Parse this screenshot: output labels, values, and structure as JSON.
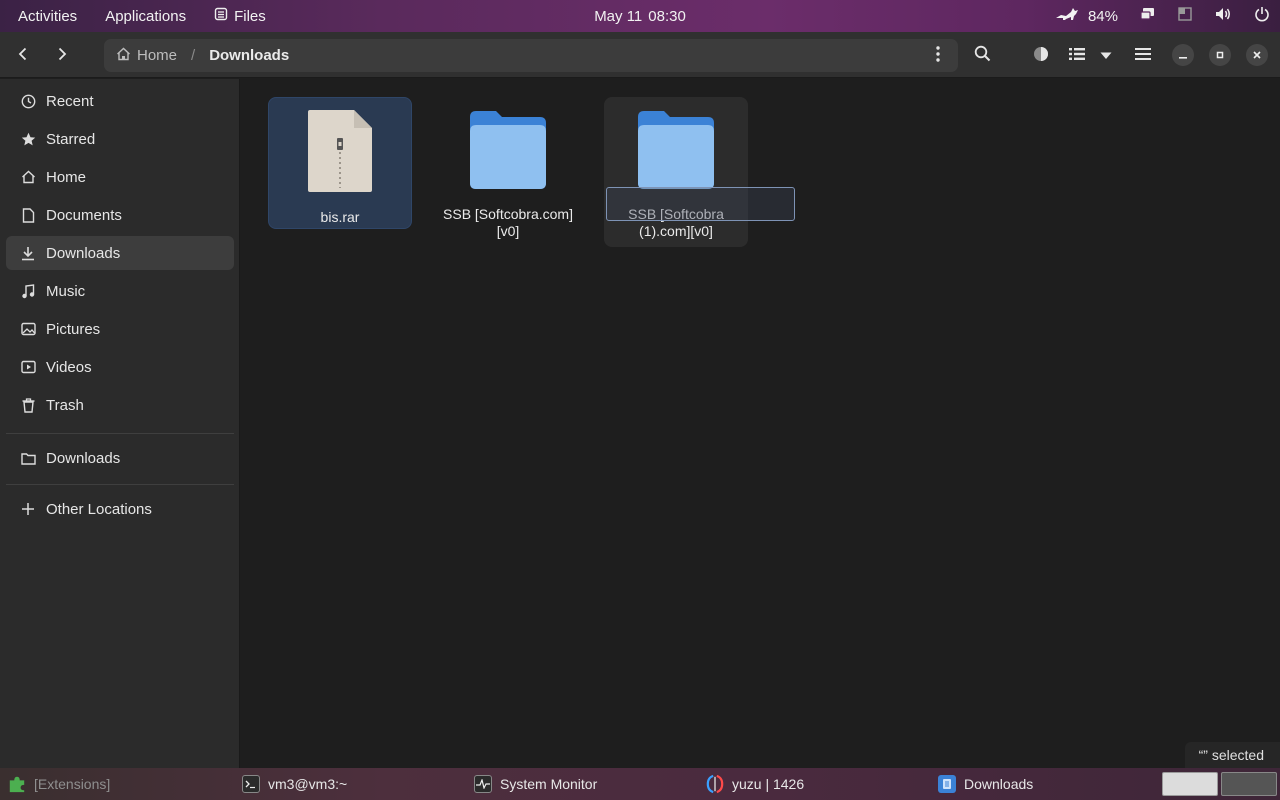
{
  "topbar": {
    "activities": "Activities",
    "applications": "Applications",
    "app_menu": "Files",
    "date": "May 11",
    "time": "08:30",
    "battery": "84%"
  },
  "headerbar": {
    "path_home": "Home",
    "path_separator": "/",
    "path_current": "Downloads"
  },
  "sidebar": {
    "items": [
      {
        "label": "Recent",
        "icon": "clock-icon"
      },
      {
        "label": "Starred",
        "icon": "star-icon"
      },
      {
        "label": "Home",
        "icon": "home-icon"
      },
      {
        "label": "Documents",
        "icon": "document-icon"
      },
      {
        "label": "Downloads",
        "icon": "download-icon",
        "active": true
      },
      {
        "label": "Music",
        "icon": "music-icon"
      },
      {
        "label": "Pictures",
        "icon": "picture-icon"
      },
      {
        "label": "Videos",
        "icon": "video-icon"
      },
      {
        "label": "Trash",
        "icon": "trash-icon"
      }
    ],
    "bookmark": {
      "label": "Downloads",
      "icon": "folder-icon"
    },
    "other_locations": {
      "label": "Other Locations",
      "icon": "plus-icon"
    }
  },
  "files": [
    {
      "name": "bis.rar",
      "type": "archive",
      "selected": true
    },
    {
      "name": "SSB [Softcobra.com][v0]",
      "type": "folder"
    },
    {
      "name": "SSB [Softcobra (1).com][v0]",
      "type": "folder",
      "hovered": true
    }
  ],
  "status": {
    "text": "“” selected"
  },
  "taskbar": {
    "extensions": "[Extensions]",
    "terminal": "vm3@vm3:~",
    "system_monitor": "System Monitor",
    "yuzu": "yuzu | 1426",
    "files": "Downloads"
  },
  "colors": {
    "folder_blue": "#5ea0e8",
    "selection_bg": "#2a3a52",
    "topbar_accent": "#6b2d6a"
  }
}
